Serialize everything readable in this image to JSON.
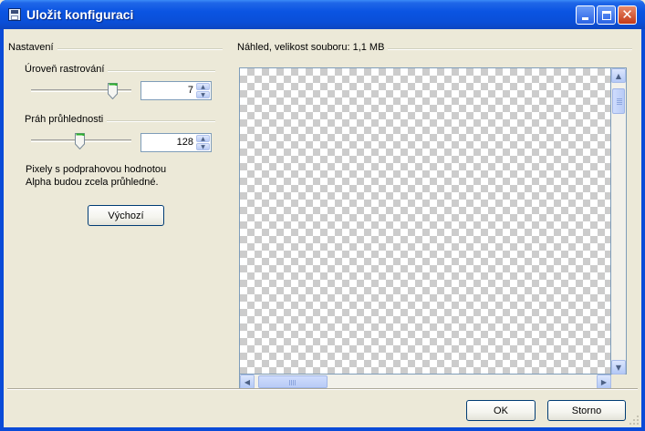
{
  "window": {
    "title": "Uložit konfiguraci",
    "icon": "floppy-disk-icon"
  },
  "settings": {
    "group_label": "Nastavení",
    "raster": {
      "label": "Úroveň rastrování",
      "value": "7",
      "slider_fraction": 0.8
    },
    "threshold": {
      "label": "Práh průhlednosti",
      "value": "128",
      "slider_fraction": 0.5
    },
    "hint_line1": "Pixely s podprahovou hodnotou",
    "hint_line2": "Alpha budou zcela průhledné.",
    "default_button": "Výchozí"
  },
  "preview": {
    "label": "Náhled, velikost souboru: 1,1 MB"
  },
  "buttons": {
    "ok": "OK",
    "cancel": "Storno"
  },
  "colors": {
    "titlebar": "#0a54e2",
    "face": "#ece9d8",
    "close": "#c43a18"
  }
}
